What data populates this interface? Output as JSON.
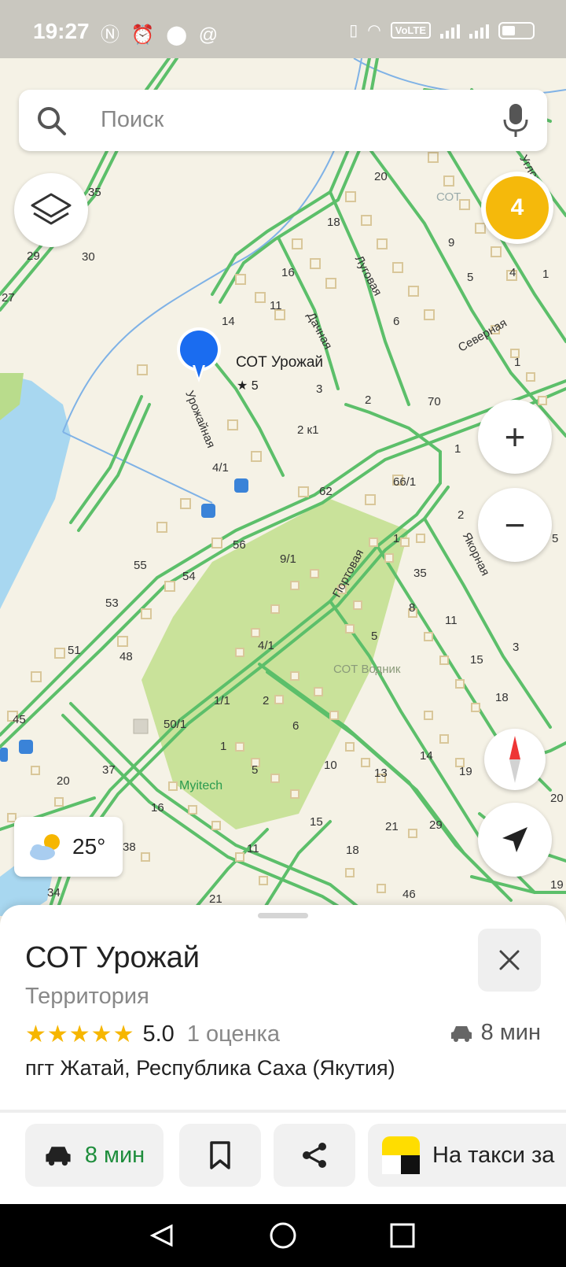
{
  "status_bar": {
    "time": "19:27",
    "left_icons": [
      "nfc-icon",
      "alarm-icon",
      "location-icon",
      "at-icon"
    ],
    "volte": "VoLTE",
    "battery": "battery-icon"
  },
  "search": {
    "placeholder": "Поиск",
    "icon": "search-icon",
    "mic_icon": "microphone-icon"
  },
  "map_controls": {
    "layers_icon": "layers-icon",
    "badge_count": "4",
    "zoom_in": "+",
    "zoom_out": "−",
    "compass_icon": "compass-icon",
    "locate_icon": "navigation-arrow-icon"
  },
  "weather": {
    "temperature": "25°",
    "icon": "partly-sunny-icon"
  },
  "map": {
    "pin": {
      "title": "СОТ Урожай",
      "rating": "★ 5"
    },
    "street_labels": [
      "Урожайная",
      "Дачная",
      "Луговая",
      "Северная",
      "Портовая",
      "Якорная",
      "Угловая"
    ],
    "area_labels": [
      "СОТ Водник",
      "СОТ",
      "Myitech"
    ],
    "house_numbers": [
      "35",
      "29",
      "30",
      "27",
      "20",
      "18",
      "16",
      "14",
      "11",
      "9",
      "5",
      "4",
      "1",
      "6",
      "3",
      "2",
      "70",
      "2 к1",
      "4/1",
      "62",
      "66/1",
      "56",
      "9/1",
      "55",
      "54",
      "53",
      "51",
      "48",
      "45",
      "50/1",
      "1/1",
      "4/1",
      "2",
      "6",
      "1",
      "5",
      "10",
      "13",
      "14",
      "19",
      "15",
      "11",
      "8",
      "5",
      "1",
      "35",
      "37",
      "20",
      "16",
      "38",
      "11",
      "15",
      "18",
      "21",
      "29",
      "34",
      "21",
      "46",
      "20",
      "19",
      "18",
      "3",
      "2",
      "1",
      "1",
      "5"
    ]
  },
  "place": {
    "title": "СОТ Урожай",
    "type": "Территория",
    "stars": "★★★★★",
    "rating_value": "5.0",
    "rating_count": "1 оценка",
    "drive_time": "8 мин",
    "address": "пгт Жатай, Республика Саха (Якутия)"
  },
  "actions": {
    "route_time": "8 мин",
    "taxi": "На такси за"
  },
  "colors": {
    "road": "#5cbf6a",
    "water": "#a8d7f0",
    "park": "#c9e29a",
    "accent_blue": "#1a6cf0",
    "badge": "#f5b90b",
    "route_green": "#1e8d3c"
  }
}
